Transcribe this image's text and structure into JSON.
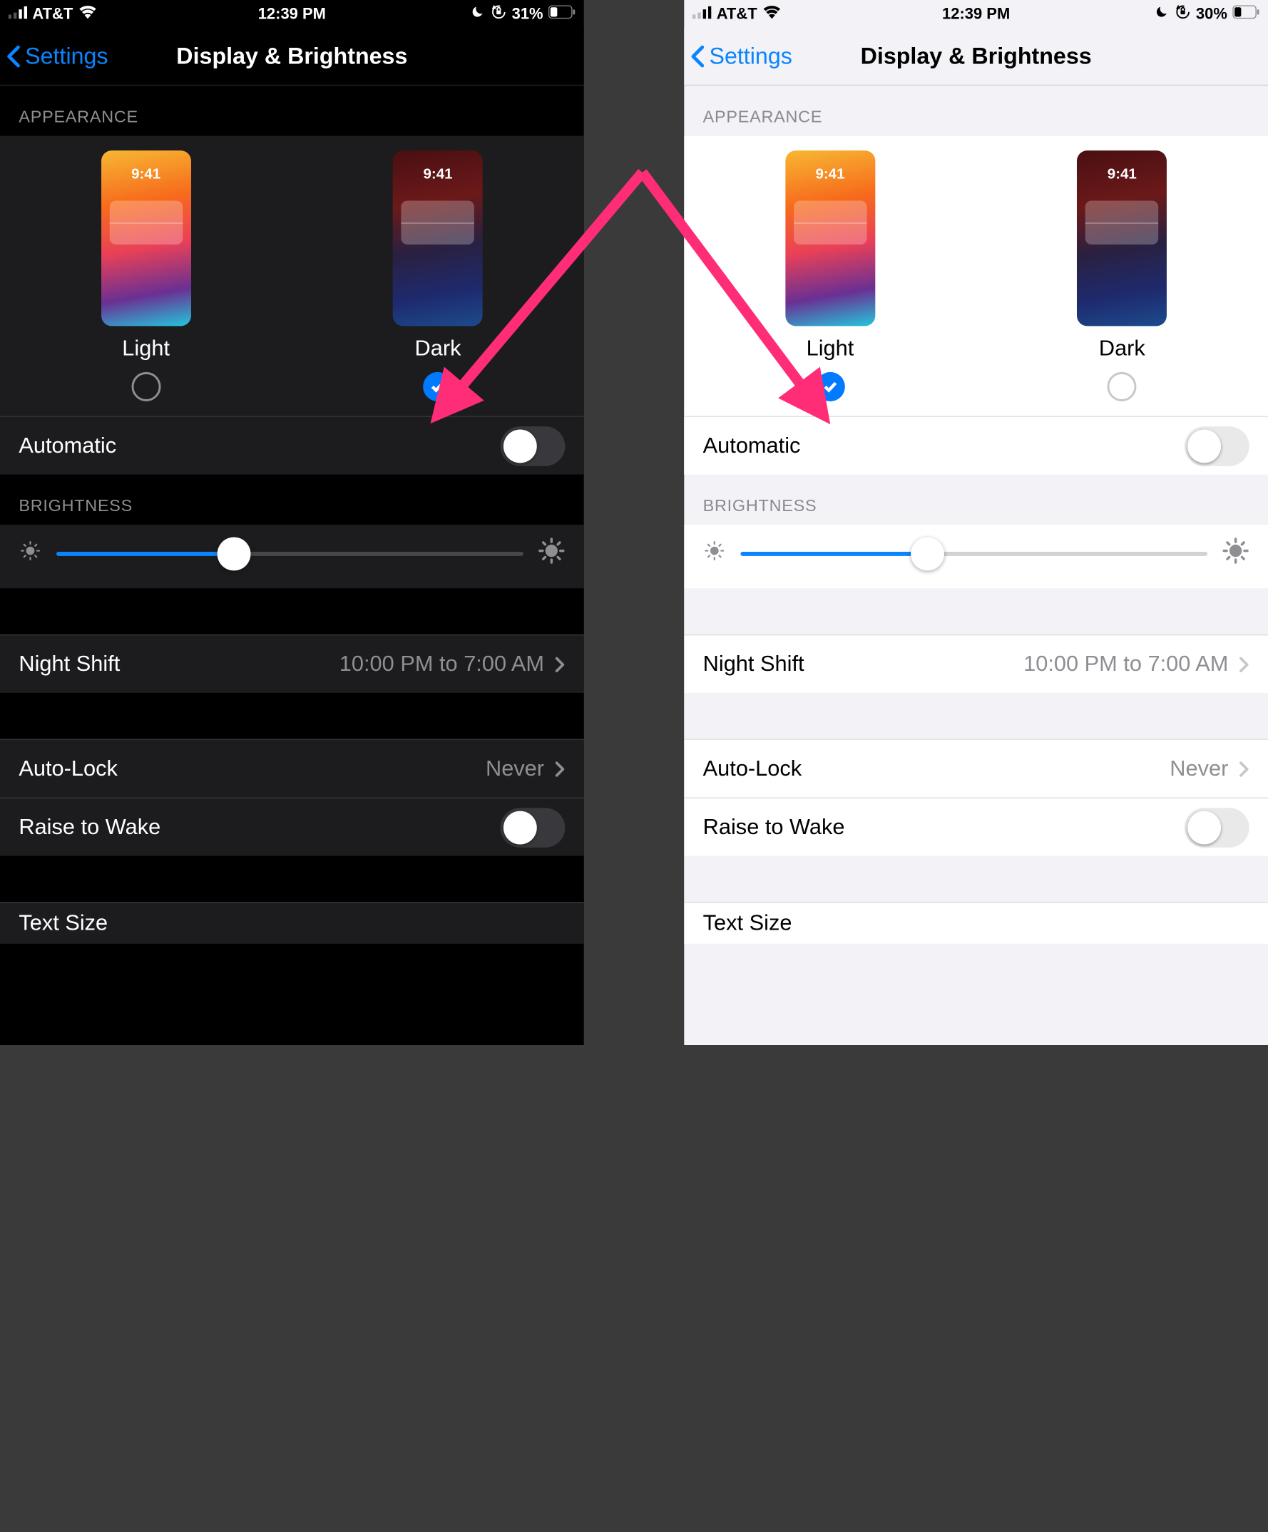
{
  "annotation_color": "#ff2d78",
  "left": {
    "status": {
      "carrier": "AT&T",
      "time": "12:39 PM",
      "battery": "31%"
    },
    "nav": {
      "back": "Settings",
      "title": "Display & Brightness"
    },
    "appearance": {
      "label": "APPEARANCE",
      "thumb_time": "9:41",
      "light_label": "Light",
      "dark_label": "Dark",
      "selected": "dark"
    },
    "automatic": {
      "label": "Automatic",
      "on": false
    },
    "brightness": {
      "label": "BRIGHTNESS",
      "percent": 38
    },
    "night_shift": {
      "label": "Night Shift",
      "detail": "10:00 PM to 7:00 AM"
    },
    "auto_lock": {
      "label": "Auto-Lock",
      "detail": "Never"
    },
    "raise_to_wake": {
      "label": "Raise to Wake",
      "on": false
    },
    "text_size": {
      "label": "Text Size"
    }
  },
  "right": {
    "status": {
      "carrier": "AT&T",
      "time": "12:39 PM",
      "battery": "30%"
    },
    "nav": {
      "back": "Settings",
      "title": "Display & Brightness"
    },
    "appearance": {
      "label": "APPEARANCE",
      "thumb_time": "9:41",
      "light_label": "Light",
      "dark_label": "Dark",
      "selected": "light"
    },
    "automatic": {
      "label": "Automatic",
      "on": false
    },
    "brightness": {
      "label": "BRIGHTNESS",
      "percent": 40
    },
    "night_shift": {
      "label": "Night Shift",
      "detail": "10:00 PM to 7:00 AM"
    },
    "auto_lock": {
      "label": "Auto-Lock",
      "detail": "Never"
    },
    "raise_to_wake": {
      "label": "Raise to Wake",
      "on": false
    },
    "text_size": {
      "label": "Text Size"
    }
  }
}
